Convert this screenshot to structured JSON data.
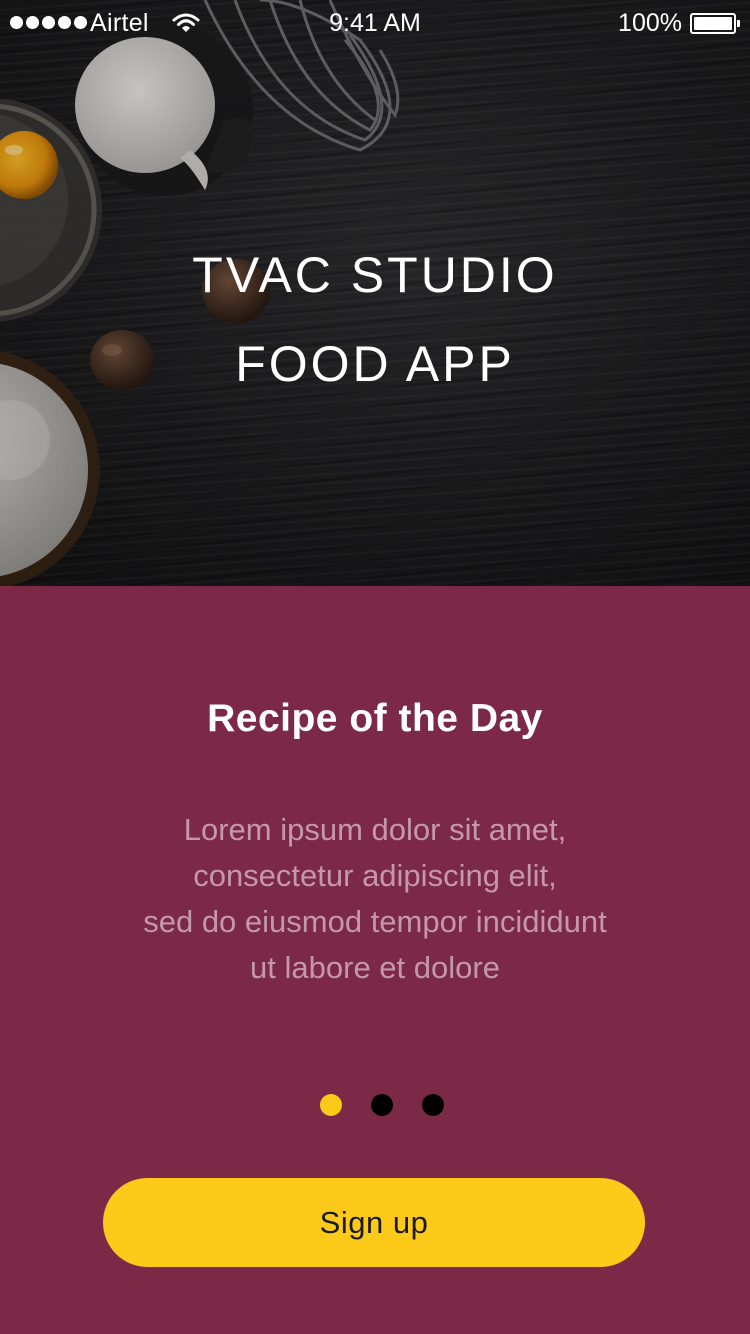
{
  "status_bar": {
    "carrier": "Airtel",
    "time": "9:41 AM",
    "battery_percent": "100%",
    "signal_bars": 5,
    "wifi_icon": "wifi-icon",
    "battery_icon": "battery-icon"
  },
  "hero": {
    "title_line1": "TVAC STUDIO",
    "title_line2": "FOOD APP"
  },
  "panel": {
    "title": "Recipe of the Day",
    "body_lines": [
      "Lorem ipsum dolor sit amet,",
      "consectetur adipiscing elit,",
      "sed do eiusmod tempor incididunt",
      "ut labore et dolore"
    ]
  },
  "pager": {
    "count": 3,
    "active_index": 0
  },
  "signup_button": {
    "label": "Sign up"
  },
  "colors": {
    "panel_background": "#7b2947",
    "accent": "#fdca1a",
    "inactive_dot": "#000000",
    "body_text": "#c497ab"
  }
}
